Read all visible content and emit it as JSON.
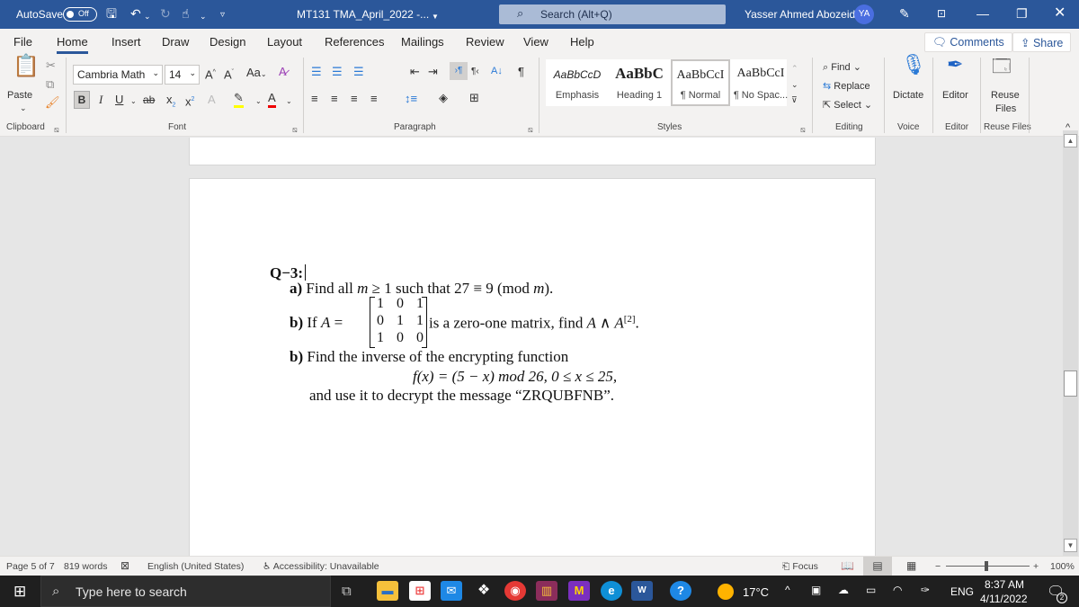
{
  "titlebar": {
    "autosave_label": "AutoSave",
    "autosave_state": "Off",
    "doc_title": "MT131 TMA_April_2022 -...",
    "search_placeholder": "Search (Alt+Q)",
    "user_name": "Yasser Ahmed Abozeid",
    "user_initials": "YA"
  },
  "tabs": [
    "File",
    "Home",
    "Insert",
    "Draw",
    "Design",
    "Layout",
    "References",
    "Mailings",
    "Review",
    "View",
    "Help"
  ],
  "active_tab": "Home",
  "actions": {
    "comments": "Comments",
    "share": "Share"
  },
  "ribbon": {
    "clipboard": {
      "paste": "Paste",
      "label": "Clipboard"
    },
    "font": {
      "name": "Cambria Math",
      "size": "14",
      "label": "Font",
      "case_btn": "Aa"
    },
    "paragraph": {
      "label": "Paragraph"
    },
    "styles": {
      "label": "Styles",
      "items": [
        {
          "preview": "AaBbCcD",
          "name": "Emphasis"
        },
        {
          "preview": "AaBbC",
          "name": "Heading 1"
        },
        {
          "preview": "AaBbCcI",
          "name": "¶ Normal"
        },
        {
          "preview": "AaBbCcI",
          "name": "¶ No Spac..."
        }
      ]
    },
    "editing": {
      "find": "Find",
      "replace": "Replace",
      "select": "Select",
      "label": "Editing"
    },
    "voice": {
      "dictate": "Dictate",
      "label": "Voice"
    },
    "editor": {
      "editor": "Editor",
      "label": "Editor"
    },
    "reuse": {
      "line1": "Reuse",
      "line2": "Files",
      "label": "Reuse Files"
    }
  },
  "document": {
    "heading": "Q−3:",
    "a_label": "a)",
    "a_text_pre": "Find all ",
    "a_var": "m",
    "a_text_mid": " ≥ 1 such that 27 ≡ 9 (mod ",
    "a_var2": "m",
    "a_text_end": ").",
    "b_label": "b)",
    "b_text_pre": "If ",
    "b_var": "A",
    "b_eq": " =",
    "matrix": [
      [
        "1",
        "0",
        "1"
      ],
      [
        "0",
        "1",
        "1"
      ],
      [
        "1",
        "0",
        "0"
      ]
    ],
    "b_text_post": " is a zero-one matrix, find ",
    "b_expr": "A ∧ A",
    "b_sup": "[2]",
    "b_end": ".",
    "c_label": "b)",
    "c_text": "Find the inverse of the encrypting function",
    "c_formula": "f(x) = (5 − x) mod 26, 0 ≤ x ≤ 25,",
    "c_text2": "and use it to decrypt the message “ZRQUBFNB”."
  },
  "statusbar": {
    "page": "Page 5 of 7",
    "words": "819 words",
    "language": "English (United States)",
    "accessibility": "Accessibility: Unavailable",
    "focus": "Focus",
    "zoom": "100%",
    "zoom_minus": "−",
    "zoom_plus": "+"
  },
  "taskbar": {
    "search_placeholder": "Type here to search",
    "temperature": "17°C",
    "language": "ENG",
    "time": "8:37 AM",
    "date": "4/11/2022",
    "notifications": "2"
  },
  "colors": {
    "brand": "#2b579a",
    "taskbar": "#1f1f1f"
  }
}
